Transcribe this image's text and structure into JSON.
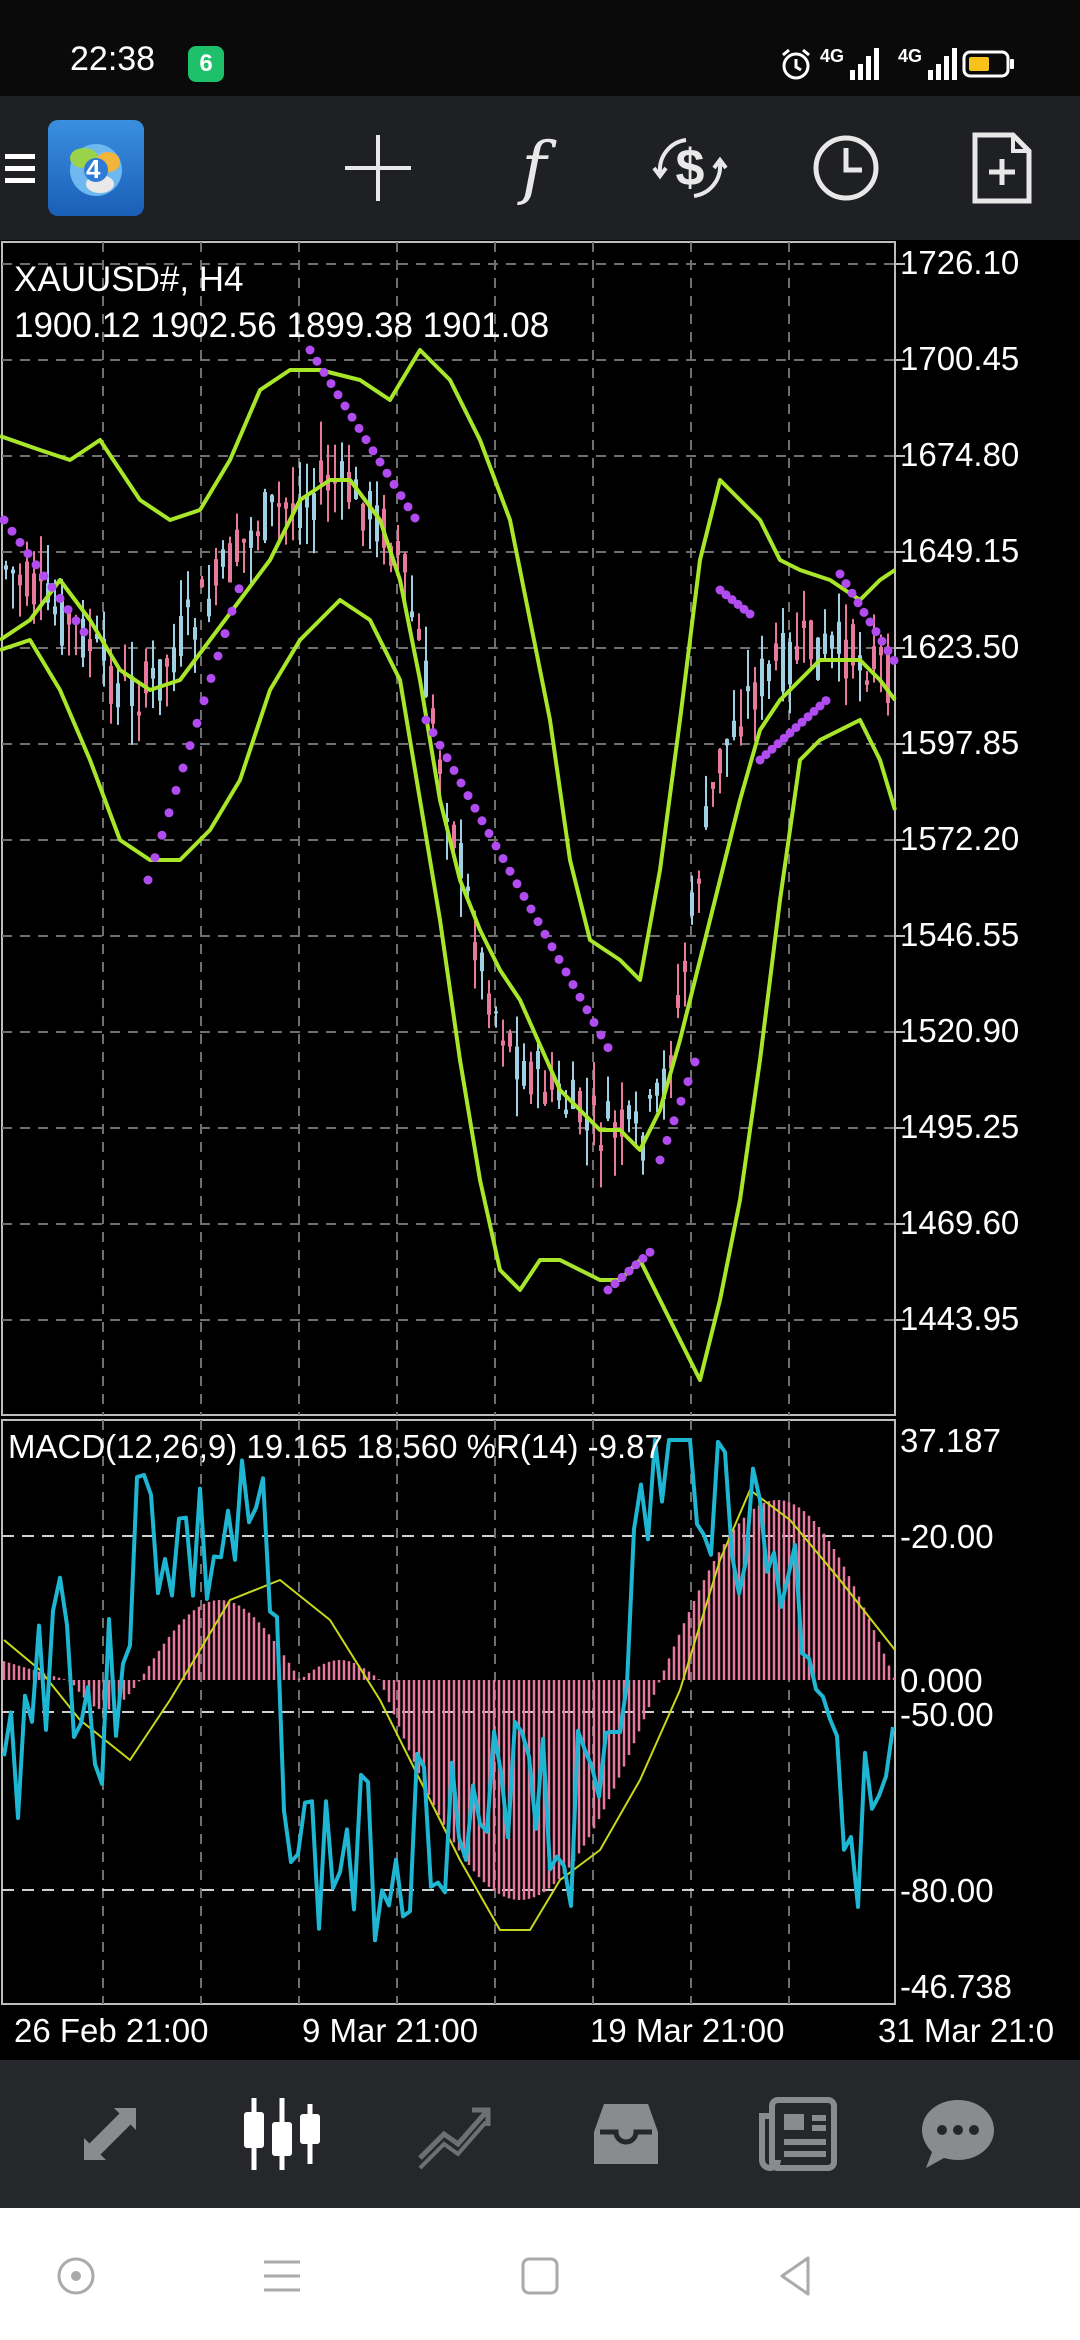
{
  "status_bar": {
    "time": "22:38",
    "app_badge": "6",
    "network1": "4G",
    "network2": "4G",
    "icons": [
      "alarm-icon",
      "signal-icon",
      "signal-icon",
      "battery-icon"
    ]
  },
  "toolbar": {
    "app_logo_number": "4",
    "buttons": [
      {
        "name": "crosshair-icon"
      },
      {
        "name": "indicators-icon",
        "label": "f"
      },
      {
        "name": "symbols-icon",
        "label": "$"
      },
      {
        "name": "timeframe-clock-icon"
      },
      {
        "name": "new-order-icon"
      }
    ]
  },
  "chart": {
    "symbol_title": "XAUUSD#, H4",
    "ohlc": "1900.12 1902.56 1899.38 1901.08",
    "price_labels": [
      "1726.10",
      "1700.45",
      "1674.80",
      "1649.15",
      "1623.50",
      "1597.85",
      "1572.20",
      "1546.55",
      "1520.90",
      "1495.25",
      "1469.60",
      "1443.95"
    ],
    "oscillator_title": "MACD(12,26,9) 19.165 18.560 %R(14) -9.87",
    "oscillator_labels": [
      "37.187",
      "-20.00",
      "0.000",
      "-50.00",
      "-80.00",
      "-46.738"
    ],
    "date_labels": [
      "26 Feb 21:00",
      "9 Mar 21:00",
      "19 Mar 21:00",
      "31 Mar 21:0"
    ],
    "colors": {
      "bollinger": "#a8e62a",
      "parabolic_sar": "#b14cf0",
      "macd_hist": "#e77a9c",
      "macd_signal": "#c8d81a",
      "williams_r": "#1eb6d3",
      "candle_up": "#e77a9c",
      "candle_down": "#9fd0e3",
      "grid": "#6f6f6f"
    }
  },
  "bottom_nav": {
    "items": [
      {
        "name": "quotes-icon",
        "active": false
      },
      {
        "name": "chart-icon",
        "active": true
      },
      {
        "name": "trade-icon",
        "active": false
      },
      {
        "name": "history-icon",
        "active": false
      },
      {
        "name": "news-icon",
        "active": false
      },
      {
        "name": "messages-icon",
        "active": false
      }
    ]
  },
  "system_nav": [
    "assistant-icon",
    "menu-icon",
    "home-icon",
    "back-icon"
  ]
}
